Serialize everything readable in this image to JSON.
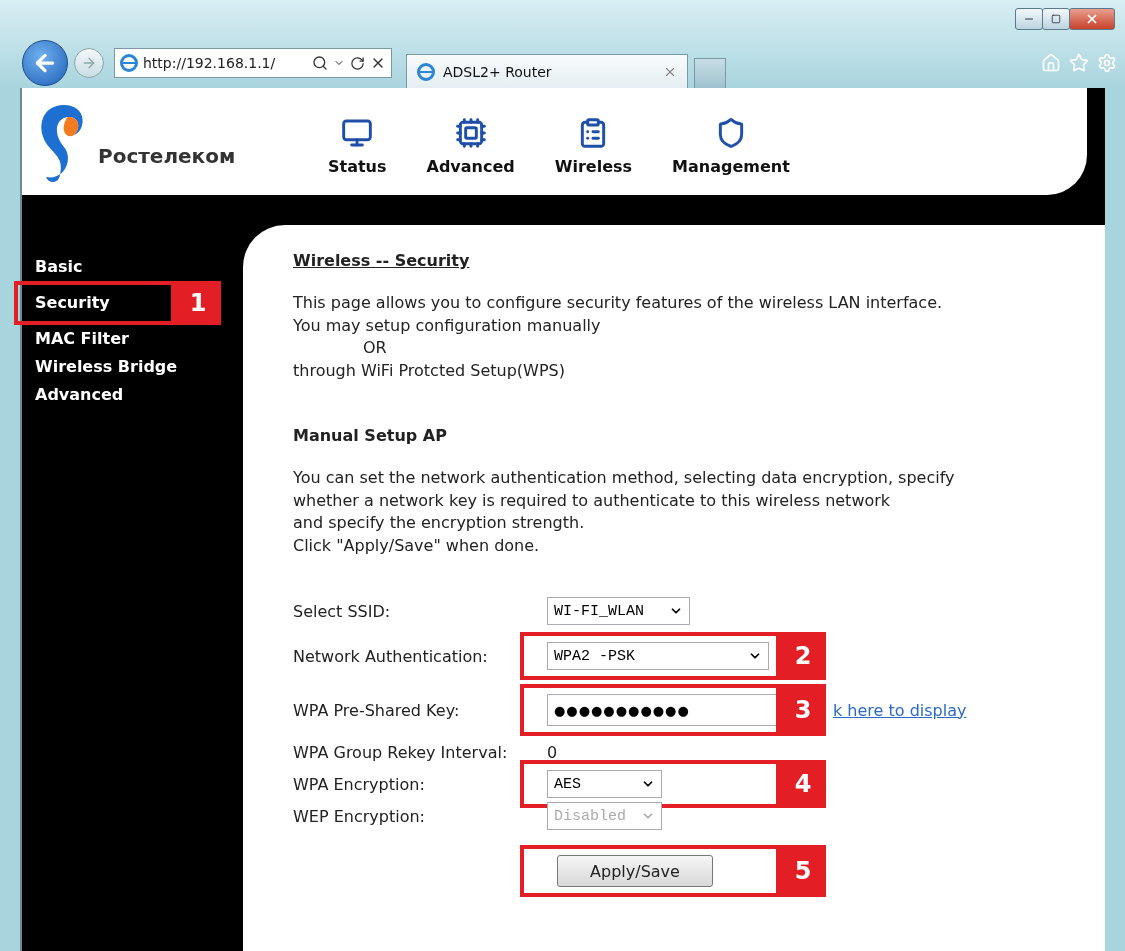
{
  "browser": {
    "url": "http://192.168.1.1/",
    "tab_title": "ADSL2+ Router"
  },
  "header": {
    "brand": "Ростелеком",
    "nav": [
      {
        "label": "Status",
        "kind": "monitor"
      },
      {
        "label": "Advanced",
        "kind": "chip"
      },
      {
        "label": "Wireless",
        "kind": "clipboard"
      },
      {
        "label": "Management",
        "kind": "shield"
      }
    ]
  },
  "sidebar": {
    "items": [
      {
        "label": "Basic"
      },
      {
        "label": "Security",
        "annotation": "1"
      },
      {
        "label": "MAC Filter"
      },
      {
        "label": "Wireless Bridge"
      },
      {
        "label": "Advanced"
      }
    ]
  },
  "content": {
    "title": "Wireless -- Security",
    "intro": [
      {
        "text": "This page allows you to configure security features of the wireless LAN interface.",
        "indent": false
      },
      {
        "text": "You may setup configuration manually",
        "indent": false
      },
      {
        "text": "OR",
        "indent": true
      },
      {
        "text": "through WiFi Protcted Setup(WPS)",
        "indent": false
      }
    ],
    "section_title": "Manual Setup AP",
    "description": [
      "You can set the network authentication method, selecting data encryption, specify whether a network key is required to authenticate to this wireless network",
      "and specify the encryption strength.",
      "Click \"Apply/Save\" when done."
    ],
    "form": [
      {
        "label": "Select SSID:",
        "kind": "select",
        "value": "WI-FI_WLAN",
        "disabled": false
      },
      {
        "label": "Network Authentication:",
        "kind": "select",
        "value": "WPA2 -PSK",
        "disabled": false,
        "annotation": "2"
      },
      {
        "label": "WPA Pre-Shared Key:",
        "kind": "password",
        "value": "●●●●●●●●●●●",
        "annotation": "3",
        "link": "k here to display"
      },
      {
        "label": "WPA Group Rekey Interval:",
        "kind": "text",
        "value": "0"
      },
      {
        "label": "WPA Encryption:",
        "kind": "select",
        "value": "AES",
        "disabled": false,
        "annotation": "4"
      },
      {
        "label": "WEP Encryption:",
        "kind": "select",
        "value": "Disabled",
        "disabled": true
      }
    ],
    "button": {
      "label": "Apply/Save",
      "annotation": "5"
    }
  }
}
